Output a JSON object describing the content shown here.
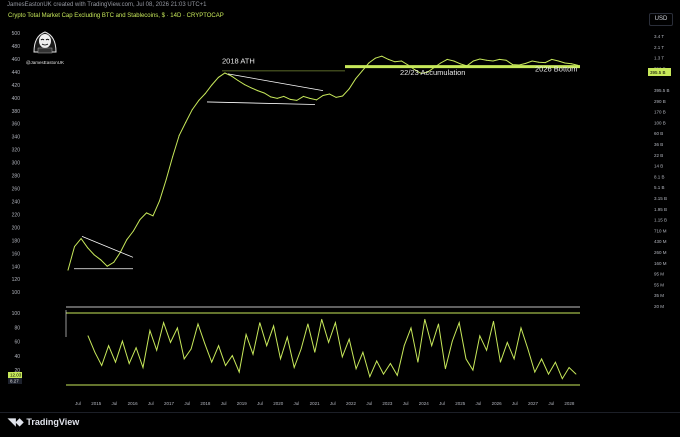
{
  "header": {
    "credit": "JamesEastonUK created with TradingView.com, Jul 08, 2026 21:03 UTC+1",
    "symbol": "Crypto Total Market Cap Excluding BTC and Stablecoins, $ · 14D · CRYPTOCAP",
    "currency_button": "USD"
  },
  "avatar": {
    "name": "@JamesEastonUK",
    "icon": "anonymous-mask-icon"
  },
  "footer": {
    "logo": "TradingView",
    "logo_icon": "tv-logo-icon"
  },
  "colors": {
    "accent": "#c7e85a",
    "background": "#000000",
    "tick_text": "#b2b5be"
  },
  "chart_data": [
    {
      "type": "line",
      "pane": "price",
      "y_scale": "log",
      "left_axis_ticks": [
        500,
        480,
        460,
        440,
        420,
        400,
        380,
        360,
        340,
        320,
        300,
        280,
        260,
        240,
        220,
        200,
        180,
        160,
        140,
        120,
        100
      ],
      "right_axis_ticks": [
        "3.4 T",
        "2.1 T",
        "1.3 T",
        "790 B",
        "",
        "395.5 B",
        "290 B",
        "170 B",
        "100 B",
        "60 B",
        "36 B",
        "22 B",
        "14 B",
        "8.1 B",
        "5.1 B",
        "3.15 B",
        "1.95 B",
        "1.15 B",
        "710 M",
        "430 M",
        "260 M",
        "160 M",
        "95 M",
        "55 M",
        "35 M",
        "20 M"
      ],
      "price_label": "395.5 B",
      "x_ticks": [
        "Jul",
        "2015",
        "Jul",
        "2016",
        "Jul",
        "2017",
        "Jul",
        "2018",
        "Jul",
        "2019",
        "Jul",
        "2020",
        "Jul",
        "2021",
        "Jul",
        "2022",
        "Jul",
        "2023",
        "Jul",
        "2024",
        "Jul",
        "2025",
        "Jul",
        "2026",
        "Jul",
        "2027",
        "Jul",
        "2028"
      ],
      "annotations": [
        {
          "text": "2018 ATH"
        },
        {
          "text": "22/23 Accumulation"
        },
        {
          "text": "2026 Bottom"
        }
      ],
      "series": [
        {
          "values": [
            132,
            151,
            158,
            150,
            144,
            140,
            135,
            138,
            146,
            157,
            165,
            176,
            183,
            180,
            196,
            221,
            252,
            285,
            307,
            330,
            348,
            362,
            380,
            397,
            407,
            400,
            390,
            381,
            374,
            368,
            363,
            355,
            352,
            356,
            350,
            348,
            356,
            352,
            349,
            358,
            361,
            354,
            357,
            372,
            394,
            412,
            431,
            443,
            448,
            440,
            434,
            436,
            426,
            415,
            406,
            409,
            420,
            431,
            440,
            436,
            429,
            424,
            436,
            441,
            438,
            436,
            440,
            438,
            427,
            426,
            430,
            436,
            433,
            432,
            440,
            436,
            431,
            429,
            425
          ]
        }
      ]
    },
    {
      "type": "line",
      "pane": "oscillator",
      "y_range": [
        0,
        100
      ],
      "left_axis_ticks": [
        100,
        80,
        60,
        40,
        20
      ],
      "value_labels": [
        "12.03",
        "8.27"
      ],
      "series": [
        {
          "values": [
            70,
            45,
            25,
            55,
            30,
            62,
            28,
            52,
            22,
            78,
            48,
            90,
            60,
            82,
            35,
            50,
            88,
            58,
            30,
            55,
            25,
            40,
            15,
            72,
            42,
            90,
            55,
            85,
            35,
            68,
            22,
            50,
            88,
            45,
            95,
            60,
            90,
            38,
            65,
            20,
            45,
            8,
            32,
            12,
            28,
            10,
            55,
            82,
            30,
            95,
            55,
            88,
            20,
            62,
            90,
            35,
            18,
            70,
            48,
            92,
            30,
            60,
            35,
            82,
            50,
            15,
            35,
            12,
            30,
            5,
            22,
            12
          ]
        }
      ]
    }
  ]
}
